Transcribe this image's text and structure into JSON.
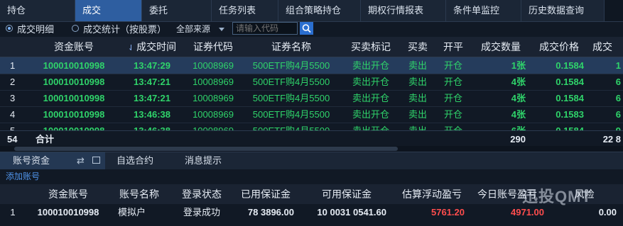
{
  "tabs": [
    "持仓",
    "成交",
    "委托",
    "任务列表",
    "组合策略持仓",
    "期权行情报表",
    "条件单监控",
    "历史数据查询"
  ],
  "active_tab": "成交",
  "filter": {
    "radio1": "成交明细",
    "radio2": "成交统计（按股票）",
    "source": "全部来源",
    "code_placeholder": "请输入代码"
  },
  "table": {
    "headers": [
      "资金账号",
      "成交时间",
      "证券代码",
      "证券名称",
      "买卖标记",
      "买卖",
      "开平",
      "成交数量",
      "成交价格",
      "成交"
    ],
    "rows": [
      {
        "idx": "1",
        "acct": "100010010998",
        "time": "13:47:29",
        "code": "10008969",
        "name": "500ETF购4月5500",
        "mark": "卖出开仓",
        "side": "卖出",
        "oc": "开仓",
        "qty": "1张",
        "price": "0.1584",
        "extra": "1"
      },
      {
        "idx": "2",
        "acct": "100010010998",
        "time": "13:47:21",
        "code": "10008969",
        "name": "500ETF购4月5500",
        "mark": "卖出开仓",
        "side": "卖出",
        "oc": "开仓",
        "qty": "4张",
        "price": "0.1584",
        "extra": "6"
      },
      {
        "idx": "3",
        "acct": "100010010998",
        "time": "13:47:21",
        "code": "10008969",
        "name": "500ETF购4月5500",
        "mark": "卖出开仓",
        "side": "卖出",
        "oc": "开仓",
        "qty": "4张",
        "price": "0.1584",
        "extra": "6"
      },
      {
        "idx": "4",
        "acct": "100010010998",
        "time": "13:46:38",
        "code": "10008969",
        "name": "500ETF购4月5500",
        "mark": "卖出开仓",
        "side": "卖出",
        "oc": "开仓",
        "qty": "4张",
        "price": "0.1583",
        "extra": "6"
      },
      {
        "idx": "5",
        "acct": "100010010998",
        "time": "13:46:38",
        "code": "10008969",
        "name": "500ETF购4月5500",
        "mark": "卖出开仓",
        "side": "卖出",
        "oc": "开仓",
        "qty": "6张",
        "price": "0.1584",
        "extra": "9"
      }
    ],
    "total_count": "54",
    "total_label": "合计",
    "total_qty": "290",
    "total_extra": "22 8"
  },
  "bottom_tabs": [
    "账号资金",
    "自选合约",
    "消息提示"
  ],
  "add_account": "添加账号",
  "account_table": {
    "headers": [
      "资金账号",
      "账号名称",
      "登录状态",
      "已用保证金",
      "可用保证金",
      "估算浮动盈亏",
      "今日账号盈亏",
      "风险"
    ],
    "row": {
      "idx": "1",
      "acct": "100010010998",
      "name": "模拟户",
      "status": "登录成功",
      "used": "78 3896.00",
      "avail": "10 0031 0541.60",
      "float": "5761.20",
      "today": "4971.00",
      "risk": "0.00"
    }
  },
  "watermark": "迅投QMT",
  "colors": {
    "accent": "#2e5ea0",
    "up": "#2fd36a",
    "loss": "#ff4d4d",
    "bg": "#111925"
  }
}
